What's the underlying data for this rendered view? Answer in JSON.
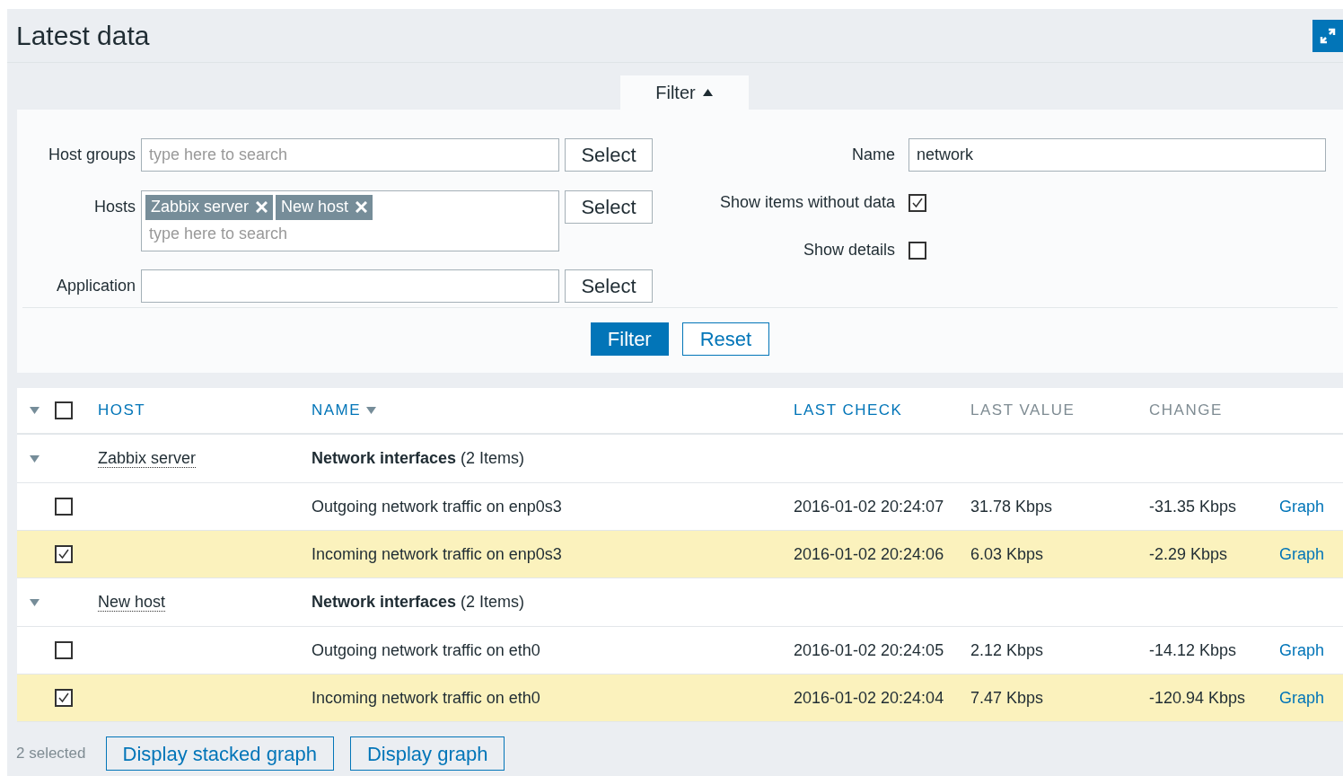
{
  "header": {
    "title": "Latest data"
  },
  "filter_tab": {
    "label": "Filter",
    "expanded": true
  },
  "filter": {
    "host_groups": {
      "label": "Host groups",
      "placeholder": "type here to search",
      "button": "Select"
    },
    "hosts": {
      "label": "Hosts",
      "tags": [
        "Zabbix server",
        "New host"
      ],
      "placeholder": "type here to search",
      "button": "Select"
    },
    "application": {
      "label": "Application",
      "button": "Select"
    },
    "name": {
      "label": "Name",
      "value": "network"
    },
    "options": [
      {
        "label": "Show items without data",
        "checked": true
      },
      {
        "label": "Show details",
        "checked": false
      }
    ],
    "buttons": [
      "Filter",
      "Reset"
    ]
  },
  "table": {
    "select_all": {
      "checked": false
    },
    "columns": [
      {
        "label": "HOST",
        "link": true,
        "sorted": false
      },
      {
        "label": "NAME",
        "link": true,
        "sorted": true
      },
      {
        "label": "LAST CHECK",
        "link": true,
        "sorted": false
      },
      {
        "label": "LAST VALUE",
        "link": false,
        "sorted": false
      },
      {
        "label": "CHANGE",
        "link": false,
        "sorted": false
      }
    ],
    "groups": [
      {
        "host": "Zabbix server",
        "application": "**Network interfaces** (2 Items)",
        "expanded": true,
        "items": [
          {
            "name": "Outgoing network traffic on enp0s3",
            "last_check": "2016-01-02 20:24:07",
            "last_value": "31.78 Kbps",
            "change": "-31.35 Kbps",
            "link": "Graph",
            "checked": false
          },
          {
            "name": "Incoming network traffic on enp0s3",
            "last_check": "2016-01-02 20:24:06",
            "last_value": "6.03 Kbps",
            "change": "-2.29 Kbps",
            "link": "Graph",
            "checked": true
          }
        ]
      },
      {
        "host": "New host",
        "application": "**Network interfaces** (2 Items)",
        "expanded": true,
        "items": [
          {
            "name": "Outgoing network traffic on eth0",
            "last_check": "2016-01-02 20:24:05",
            "last_value": "2.12 Kbps",
            "change": "-14.12 Kbps",
            "link": "Graph",
            "checked": false
          },
          {
            "name": "Incoming network traffic on eth0",
            "last_check": "2016-01-02 20:24:04",
            "last_value": "7.47 Kbps",
            "change": "-120.94 Kbps",
            "link": "Graph",
            "checked": true
          }
        ]
      }
    ]
  },
  "footer": {
    "selected": "2 selected",
    "buttons": [
      "Display stacked graph",
      "Display graph"
    ]
  }
}
